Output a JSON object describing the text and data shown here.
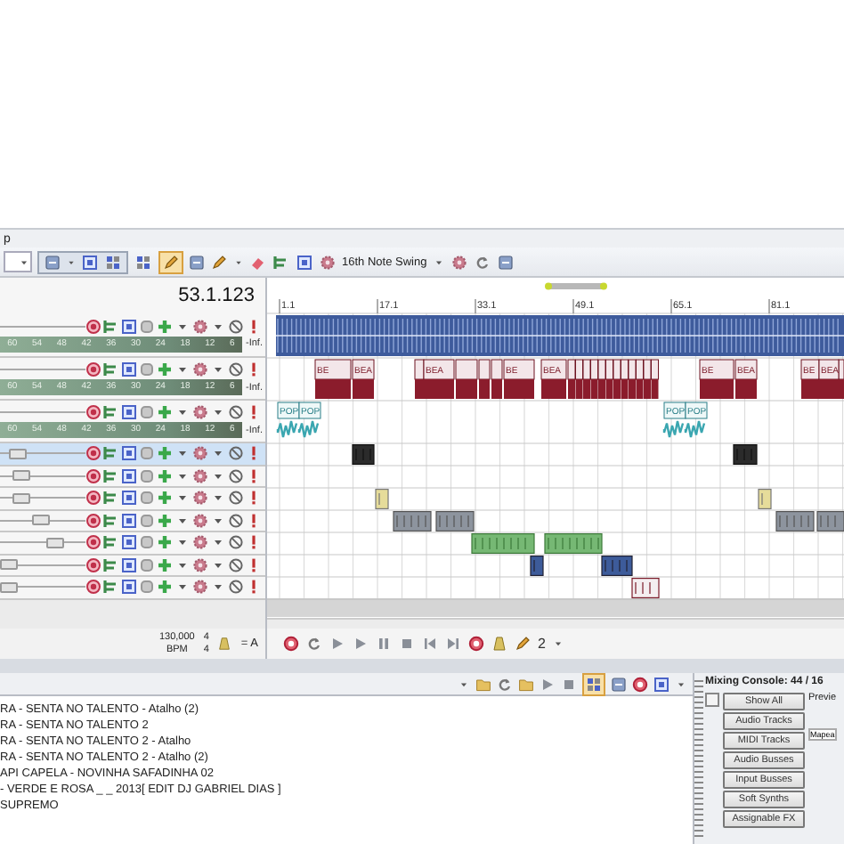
{
  "menu_bar": {
    "items": [
      "p"
    ]
  },
  "toolbar": {
    "swing": "16th Note Swing"
  },
  "time_display": "53.1.123",
  "ruler": {
    "marks": [
      "1.1",
      "17.1",
      "33.1",
      "49.1",
      "65.1",
      "81.1"
    ]
  },
  "tracks": [
    {
      "kind": "audio",
      "selected": false,
      "meter": {
        "scale": [
          "60",
          "54",
          "48",
          "42",
          "36",
          "30",
          "24",
          "18",
          "12",
          "6"
        ],
        "reading": "-Inf."
      }
    },
    {
      "kind": "audio",
      "selected": false,
      "meter": {
        "scale": [
          "60",
          "54",
          "48",
          "42",
          "36",
          "30",
          "24",
          "18",
          "12",
          "6"
        ],
        "reading": "-Inf."
      },
      "clips": [
        "BE",
        "BEA",
        "BEA",
        "BE",
        "BEA",
        "BE",
        "BEA",
        "BE",
        "BEA"
      ]
    },
    {
      "kind": "audio",
      "selected": false,
      "meter": {
        "scale": [
          "60",
          "54",
          "48",
          "42",
          "36",
          "30",
          "24",
          "18",
          "12",
          "6"
        ],
        "reading": "-Inf."
      },
      "clips": [
        "POP",
        "POP",
        "POP",
        "POP"
      ]
    },
    {
      "kind": "compact",
      "selected": true,
      "level": 0.2
    },
    {
      "kind": "compact",
      "selected": false,
      "level": 0.26
    },
    {
      "kind": "compact",
      "selected": false,
      "level": 0.26
    },
    {
      "kind": "compact",
      "selected": false,
      "level": 0.48
    },
    {
      "kind": "compact",
      "selected": false,
      "level": 0.64
    },
    {
      "kind": "compact",
      "selected": false,
      "level": 0.1
    },
    {
      "kind": "compact",
      "selected": false,
      "level": 0.1
    }
  ],
  "tempo": {
    "bpm": "130,000",
    "unit": "BPM",
    "beats": "4",
    "beat_value": "4",
    "key": "= A"
  },
  "transport": {
    "count": "2"
  },
  "explorer": {
    "files": [
      "RA - SENTA NO TALENTO - Atalho (2)",
      "RA - SENTA NO TALENTO 2",
      "RA - SENTA NO TALENTO 2 - Atalho",
      "RA - SENTA NO TALENTO 2 - Atalho (2)",
      "API CAPELA - NOVINHA SAFADINHA 02",
      "- VERDE E ROSA _ _ 2013[ EDIT DJ GABRIEL DIAS ]",
      "SUPREMO"
    ]
  },
  "mixing_console": {
    "title": "Mixing Console: 44 / 16",
    "buttons": [
      "Show All",
      "Audio Tracks",
      "MIDI Tracks",
      "Audio Busses",
      "Input Busses",
      "Soft Synths",
      "Assignable FX"
    ],
    "preview_label": "Previe",
    "field_value": "Mapea"
  }
}
